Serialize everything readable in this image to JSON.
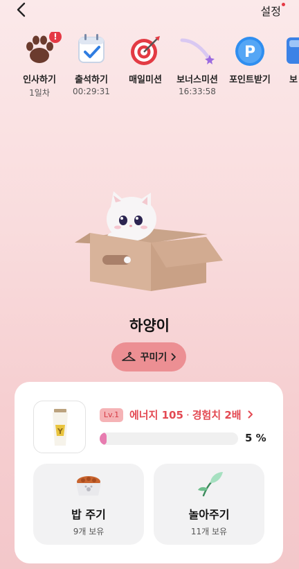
{
  "header": {
    "settings_label": "설정"
  },
  "missions": [
    {
      "label": "인사하기",
      "sub": "1일차",
      "badge": "!"
    },
    {
      "label": "출석하기",
      "sub": "00:29:31"
    },
    {
      "label": "매일미션",
      "sub": ""
    },
    {
      "label": "보너스미션",
      "sub": "16:33:58"
    },
    {
      "label": "포인트받기",
      "sub": ""
    },
    {
      "label": "보",
      "sub": ""
    }
  ],
  "pet": {
    "name": "하양이",
    "decorate_label": "꾸미기"
  },
  "status": {
    "level": "Lv.1",
    "energy": "에너지 105",
    "dot": "·",
    "exp": "경험치 2배",
    "progress_percent": 5,
    "progress_label": "5 %"
  },
  "actions": [
    {
      "label": "밥 주기",
      "sub": "9개 보유"
    },
    {
      "label": "놀아주기",
      "sub": "11개 보유"
    }
  ],
  "colors": {
    "accent": "#e34952",
    "button": "#ec8f93",
    "progress": "#e77cb0"
  }
}
